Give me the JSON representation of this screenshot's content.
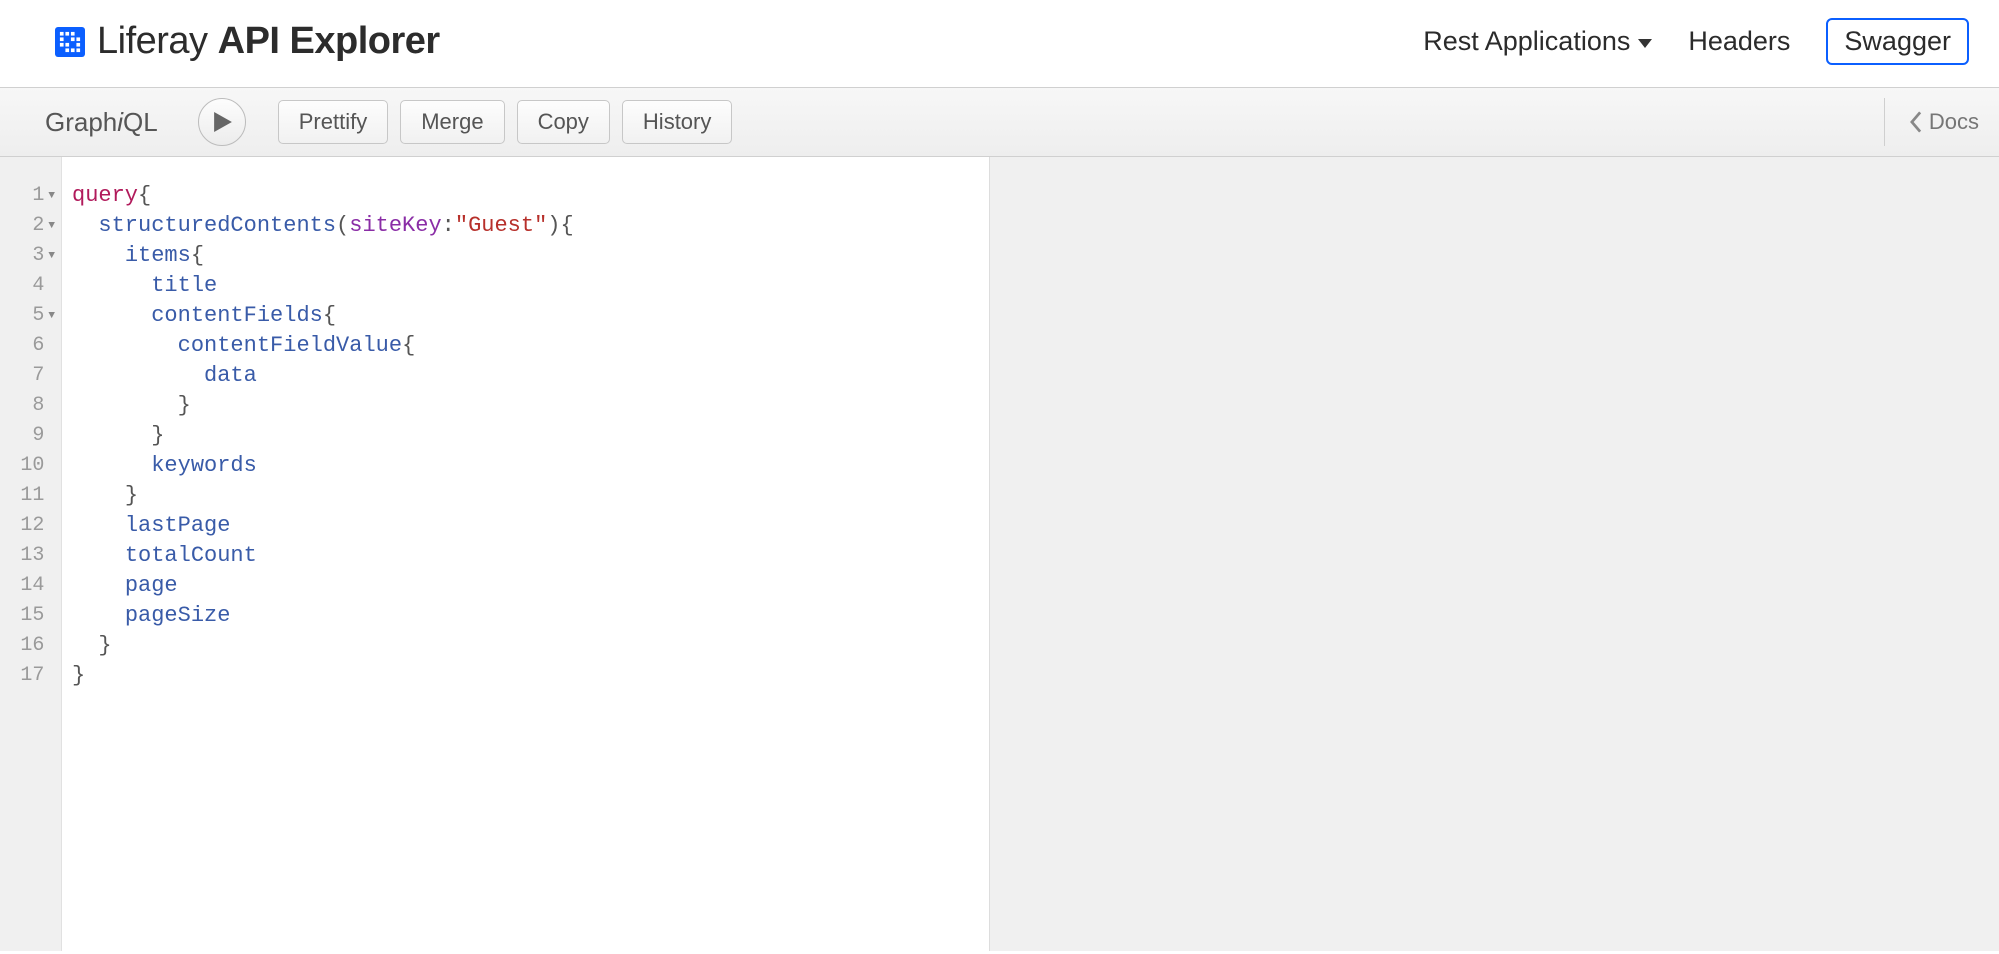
{
  "header": {
    "brand_prefix": "Liferay",
    "brand_suffix": "API Explorer",
    "nav": {
      "rest_apps": "Rest Applications",
      "headers": "Headers",
      "swagger": "Swagger"
    }
  },
  "toolbar": {
    "label_graph": "Graph",
    "label_i": "i",
    "label_ql": "QL",
    "prettify": "Prettify",
    "merge": "Merge",
    "copy": "Copy",
    "history": "History",
    "docs": "Docs"
  },
  "editor": {
    "lines": [
      {
        "n": "1",
        "fold": true
      },
      {
        "n": "2",
        "fold": true
      },
      {
        "n": "3",
        "fold": true
      },
      {
        "n": "4",
        "fold": false
      },
      {
        "n": "5",
        "fold": true
      },
      {
        "n": "6",
        "fold": false
      },
      {
        "n": "7",
        "fold": false
      },
      {
        "n": "8",
        "fold": false
      },
      {
        "n": "9",
        "fold": false
      },
      {
        "n": "10",
        "fold": false
      },
      {
        "n": "11",
        "fold": false
      },
      {
        "n": "12",
        "fold": false
      },
      {
        "n": "13",
        "fold": false
      },
      {
        "n": "14",
        "fold": false
      },
      {
        "n": "15",
        "fold": false
      },
      {
        "n": "16",
        "fold": false
      },
      {
        "n": "17",
        "fold": false
      }
    ],
    "code": {
      "l1_kw": "query",
      "l1_b": "{",
      "l2_def": "structuredContents",
      "l2_p1": "(",
      "l2_attr": "siteKey",
      "l2_c": ":",
      "l2_str": "\"Guest\"",
      "l2_p2": ")",
      "l2_b": "{",
      "l3_def": "items",
      "l3_b": "{",
      "l4_def": "title",
      "l5_def": "contentFields",
      "l5_b": "{",
      "l6_def": "contentFieldValue",
      "l6_b": "{",
      "l7_def": "data",
      "l8_b": "}",
      "l9_b": "}",
      "l10_def": "keywords",
      "l11_b": "}",
      "l12_def": "lastPage",
      "l13_def": "totalCount",
      "l14_def": "page",
      "l15_def": "pageSize",
      "l16_b": "}",
      "l17_b": "}"
    }
  }
}
